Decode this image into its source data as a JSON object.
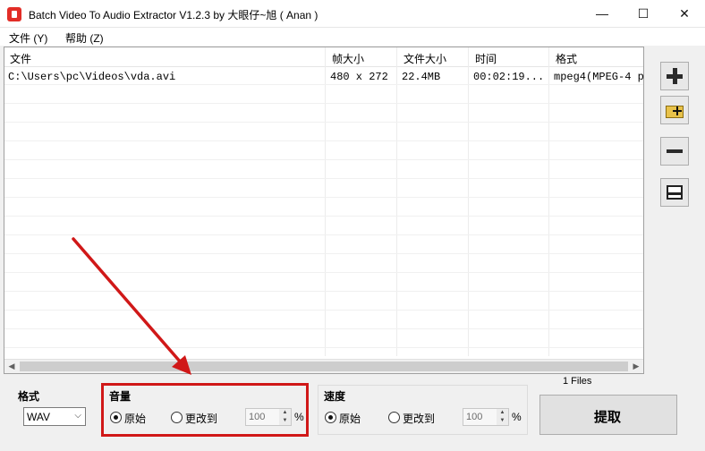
{
  "window": {
    "title": "Batch Video To Audio Extractor V1.2.3 by 大眼仔~旭 ( Anan )",
    "minimize_glyph": "—",
    "maximize_glyph": "☐",
    "close_glyph": "✕"
  },
  "menu": {
    "items": [
      {
        "label": "文件 (Y)"
      },
      {
        "label": "帮助 (Z)"
      }
    ]
  },
  "file_list": {
    "columns": [
      "文件",
      "帧大小",
      "文件大小",
      "时间",
      "格式"
    ],
    "rows": [
      {
        "file": "C:\\Users\\pc\\Videos\\vda.avi",
        "frame_size": "480 x 272",
        "file_size": "22.4MB",
        "time": "00:02:19...",
        "format": "mpeg4(MPEG-4 p"
      }
    ],
    "scroll_left_glyph": "◀",
    "scroll_right_glyph": "▶"
  },
  "toolbar": {
    "icons": [
      "add-file-icon",
      "add-folder-icon",
      "remove-icon",
      "clear-list-icon"
    ]
  },
  "status": {
    "file_count": "1 Files"
  },
  "format_group": {
    "label": "格式",
    "value": "WAV",
    "arrow_glyph": "⌵"
  },
  "volume_group": {
    "label": "音量",
    "original": "原始",
    "change_to": "更改到",
    "value": "100",
    "unit": "%"
  },
  "speed_group": {
    "label": "速度",
    "original": "原始",
    "change_to": "更改到",
    "value": "100",
    "unit": "%"
  },
  "spin_glyphs": {
    "up": "▲",
    "down": "▼"
  },
  "extract_button": {
    "label": "提取"
  },
  "colors": {
    "annotation_red": "#d01818",
    "app_icon_red": "#e22d27"
  }
}
